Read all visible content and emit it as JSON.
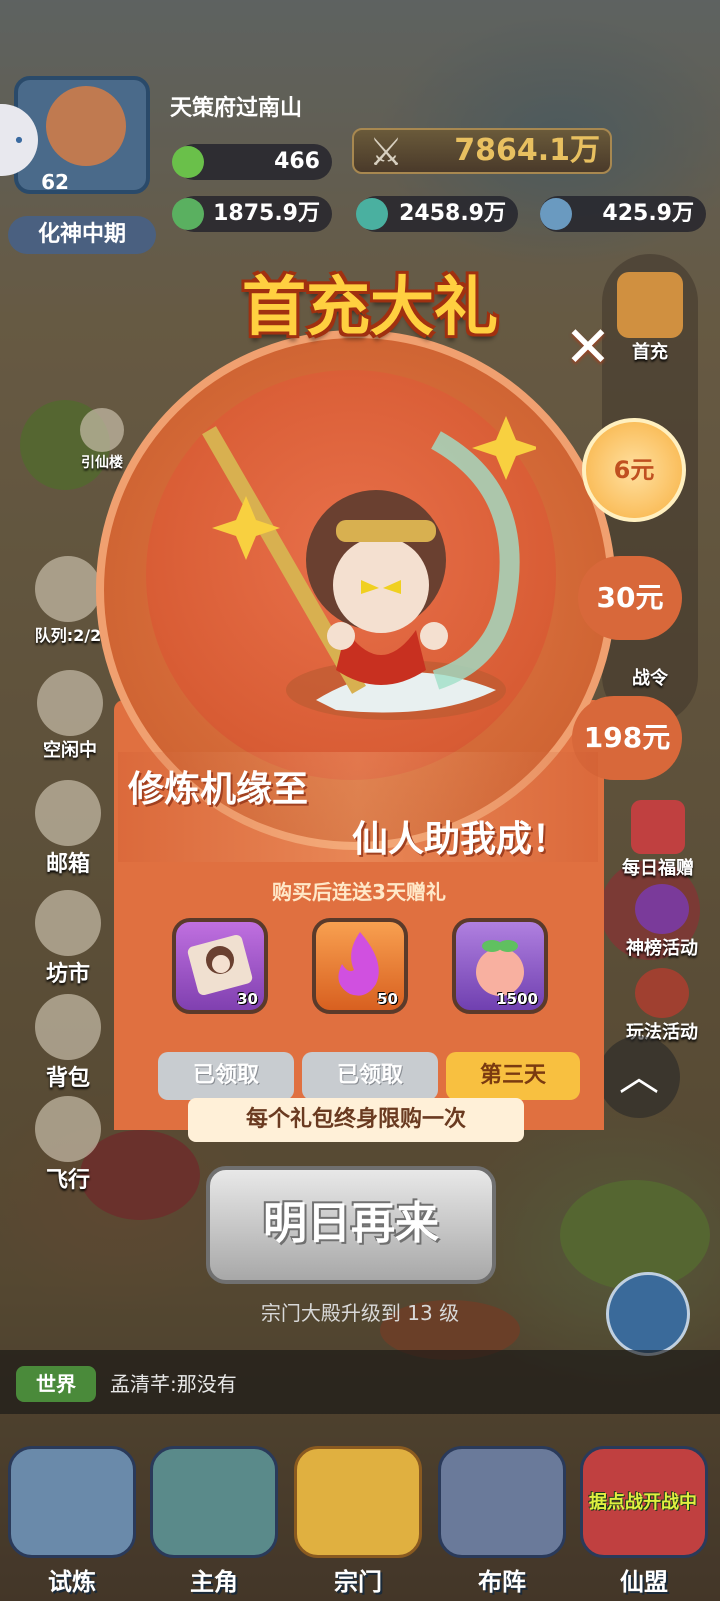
{
  "hud": {
    "player_name": "天策府过南山",
    "avatar_level": "62",
    "rank": "化神中期",
    "power": "7864.1万",
    "resources": [
      "466",
      "1875.9万",
      "2458.9万",
      "425.9万"
    ]
  },
  "side_right": {
    "first_recharge": "首充",
    "battle_pass": "战令",
    "daily_gift": "每日福赠",
    "ranking_event": "神榜活动",
    "gameplay_event": "玩法活动"
  },
  "side_left": {
    "lure": "引仙楼",
    "team": "队列:2/2",
    "idle": "空闲中",
    "mail": "邮箱",
    "market": "坊市",
    "bag": "背包",
    "fly": "飞行"
  },
  "popup": {
    "title": "首充大礼",
    "close": "✕",
    "prices": [
      "6元",
      "30元",
      "198元"
    ],
    "slogan_line1": "修炼机缘至",
    "slogan_line2": "仙人助我成！",
    "gift_caption": "购买后连送3天赠礼",
    "items": [
      {
        "name": "monkey-king-card",
        "qty": "30"
      },
      {
        "name": "spirit-flame",
        "qty": "50"
      },
      {
        "name": "peach",
        "qty": "1500"
      }
    ],
    "buttons": [
      "已领取",
      "已领取",
      "第三天"
    ],
    "limit_notice": "每个礼包终身限购一次",
    "come_tomorrow": "明日再来"
  },
  "tip": "宗门大殿升级到 13 级",
  "chat": {
    "channel": "世界",
    "message": "孟清芊:那没有"
  },
  "nav": [
    "试炼",
    "主角",
    "宗门",
    "布阵",
    "仙盟"
  ],
  "nav_badge": "据点战开战中",
  "colors": {
    "popup_orange": "#e07040",
    "title_gold": "#ffd040",
    "claimed_gray": "#c8ccd0",
    "day_three_gold": "#f8c040"
  }
}
